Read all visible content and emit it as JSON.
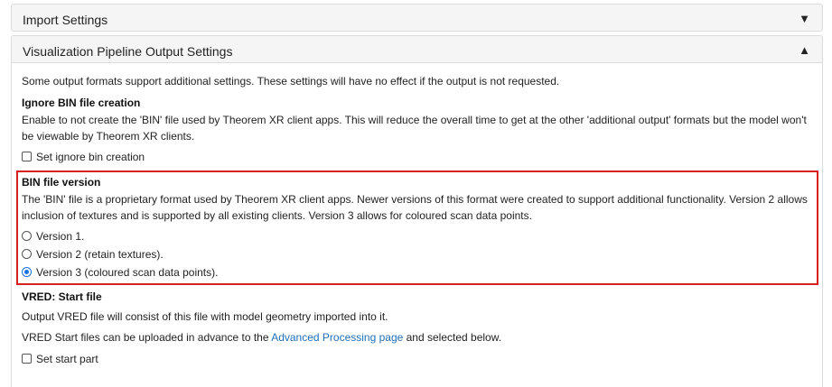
{
  "panels": {
    "import": {
      "title": "Import Settings",
      "caret": "▼"
    },
    "viz": {
      "title": "Visualization Pipeline Output Settings",
      "caret": "▲"
    }
  },
  "intro": "Some output formats support additional settings. These settings will have no effect if the output is not requested.",
  "ignore_bin": {
    "heading": "Ignore BIN file creation",
    "description": "Enable to not create the 'BIN' file used by Theorem XR client apps. This will reduce the overall time to get at the other 'additional output' formats but the model won't be viewable by Theorem XR clients.",
    "checkbox_label": "Set ignore bin creation",
    "checked": false
  },
  "bin_version": {
    "heading": "BIN file version",
    "description": "The 'BIN' file is a proprietary format used by Theorem XR client apps. Newer versions of this format were created to support additional functionality. Version 2 allows inclusion of textures and is supported by all existing clients. Version 3 allows for coloured scan data points.",
    "options": [
      {
        "label": "Version 1.",
        "selected": false
      },
      {
        "label": "Version 2 (retain textures).",
        "selected": false
      },
      {
        "label": "Version 3 (coloured scan data points).",
        "selected": true
      }
    ],
    "highlight_color": "#d9201f"
  },
  "vred": {
    "heading": "VRED: Start file",
    "line1": "Output VRED file will consist of this file with model geometry imported into it.",
    "line2_prefix": "VRED Start files can be uploaded in advance to the ",
    "line2_link": "Advanced Processing page",
    "line2_suffix": " and selected below.",
    "checkbox_label": "Set start part",
    "checked": false
  },
  "colors": {
    "link": "#1f6fb8",
    "radio_selected": "#1a73e8"
  }
}
